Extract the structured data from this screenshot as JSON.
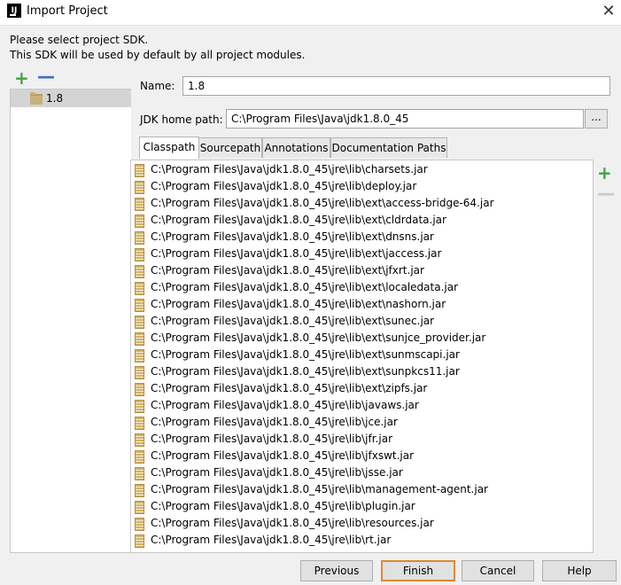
{
  "window": {
    "title": "Import Project",
    "app_icon_text": "IJ",
    "close_glyph": "✕"
  },
  "description": {
    "line1": "Please select project SDK.",
    "line2": "This SDK will be used by default by all project modules."
  },
  "sdk_list": {
    "add_glyph": "+",
    "remove_glyph": "—",
    "items": [
      {
        "label": "1.8",
        "icon": "folder-icon"
      }
    ]
  },
  "form": {
    "name_label": "Name:",
    "name_value": "1.8",
    "jdk_label": "JDK home path:",
    "jdk_value": "C:\\Program Files\\Java\\jdk1.8.0_45",
    "browse_label": "..."
  },
  "tabs": [
    {
      "label": "Classpath",
      "active": true
    },
    {
      "label": "Sourcepath",
      "active": false
    },
    {
      "label": "Annotations",
      "active": false
    },
    {
      "label": "Documentation Paths",
      "active": false
    }
  ],
  "classpath": {
    "add_glyph": "+",
    "remove_glyph": "—",
    "items": [
      "C:\\Program Files\\Java\\jdk1.8.0_45\\jre\\lib\\charsets.jar",
      "C:\\Program Files\\Java\\jdk1.8.0_45\\jre\\lib\\deploy.jar",
      "C:\\Program Files\\Java\\jdk1.8.0_45\\jre\\lib\\ext\\access-bridge-64.jar",
      "C:\\Program Files\\Java\\jdk1.8.0_45\\jre\\lib\\ext\\cldrdata.jar",
      "C:\\Program Files\\Java\\jdk1.8.0_45\\jre\\lib\\ext\\dnsns.jar",
      "C:\\Program Files\\Java\\jdk1.8.0_45\\jre\\lib\\ext\\jaccess.jar",
      "C:\\Program Files\\Java\\jdk1.8.0_45\\jre\\lib\\ext\\jfxrt.jar",
      "C:\\Program Files\\Java\\jdk1.8.0_45\\jre\\lib\\ext\\localedata.jar",
      "C:\\Program Files\\Java\\jdk1.8.0_45\\jre\\lib\\ext\\nashorn.jar",
      "C:\\Program Files\\Java\\jdk1.8.0_45\\jre\\lib\\ext\\sunec.jar",
      "C:\\Program Files\\Java\\jdk1.8.0_45\\jre\\lib\\ext\\sunjce_provider.jar",
      "C:\\Program Files\\Java\\jdk1.8.0_45\\jre\\lib\\ext\\sunmscapi.jar",
      "C:\\Program Files\\Java\\jdk1.8.0_45\\jre\\lib\\ext\\sunpkcs11.jar",
      "C:\\Program Files\\Java\\jdk1.8.0_45\\jre\\lib\\ext\\zipfs.jar",
      "C:\\Program Files\\Java\\jdk1.8.0_45\\jre\\lib\\javaws.jar",
      "C:\\Program Files\\Java\\jdk1.8.0_45\\jre\\lib\\jce.jar",
      "C:\\Program Files\\Java\\jdk1.8.0_45\\jre\\lib\\jfr.jar",
      "C:\\Program Files\\Java\\jdk1.8.0_45\\jre\\lib\\jfxswt.jar",
      "C:\\Program Files\\Java\\jdk1.8.0_45\\jre\\lib\\jsse.jar",
      "C:\\Program Files\\Java\\jdk1.8.0_45\\jre\\lib\\management-agent.jar",
      "C:\\Program Files\\Java\\jdk1.8.0_45\\jre\\lib\\plugin.jar",
      "C:\\Program Files\\Java\\jdk1.8.0_45\\jre\\lib\\resources.jar",
      "C:\\Program Files\\Java\\jdk1.8.0_45\\jre\\lib\\rt.jar"
    ]
  },
  "buttons": {
    "previous": "Previous",
    "finish": "Finish",
    "cancel": "Cancel",
    "help": "Help"
  },
  "colors": {
    "add_green": "#3ea444",
    "remove_blue": "#3b6fc4",
    "default_button_border": "#e18733",
    "selection_gray": "#d4d4d4"
  }
}
